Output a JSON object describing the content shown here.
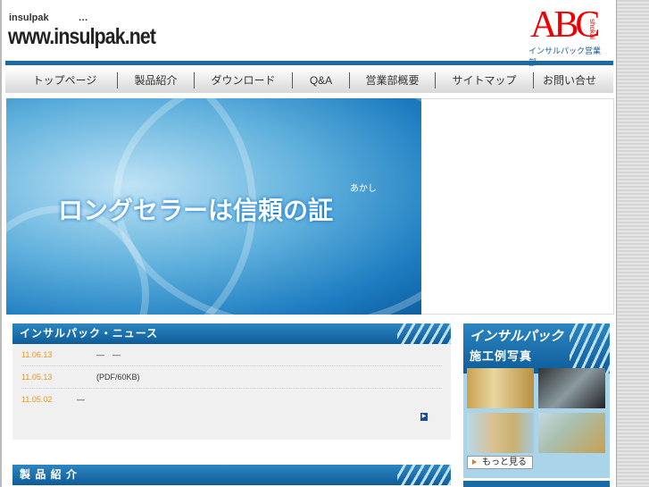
{
  "header": {
    "tagline": "insulpak　　　…",
    "site_url": "www.insulpak.net",
    "logo_text": "ABC",
    "logo_shokai": "shokai",
    "logo_sub": "インサルパック営業部"
  },
  "nav": [
    {
      "label": "トップページ"
    },
    {
      "label": "製品紹介"
    },
    {
      "label": "ダウンロード"
    },
    {
      "label": "Q&A"
    },
    {
      "label": "営業部概要"
    },
    {
      "label": "サイトマップ"
    },
    {
      "label": "お問い合せ"
    }
  ],
  "banner": {
    "text": "ロングセラーは信頼の証",
    "ruby": "あかし"
  },
  "news": {
    "title": "インサルパック・ニュース",
    "items": [
      {
        "date": "11.06.13",
        "text": "―　―"
      },
      {
        "date": "11.05.13",
        "text": "(PDF/60KB)"
      },
      {
        "date": "11.05.02",
        "text": "―"
      }
    ]
  },
  "products": {
    "title": "製 品 紹 介"
  },
  "photos": {
    "brand": "インサルパック",
    "title": "施工例写真",
    "more_label": "もっと見る"
  }
}
